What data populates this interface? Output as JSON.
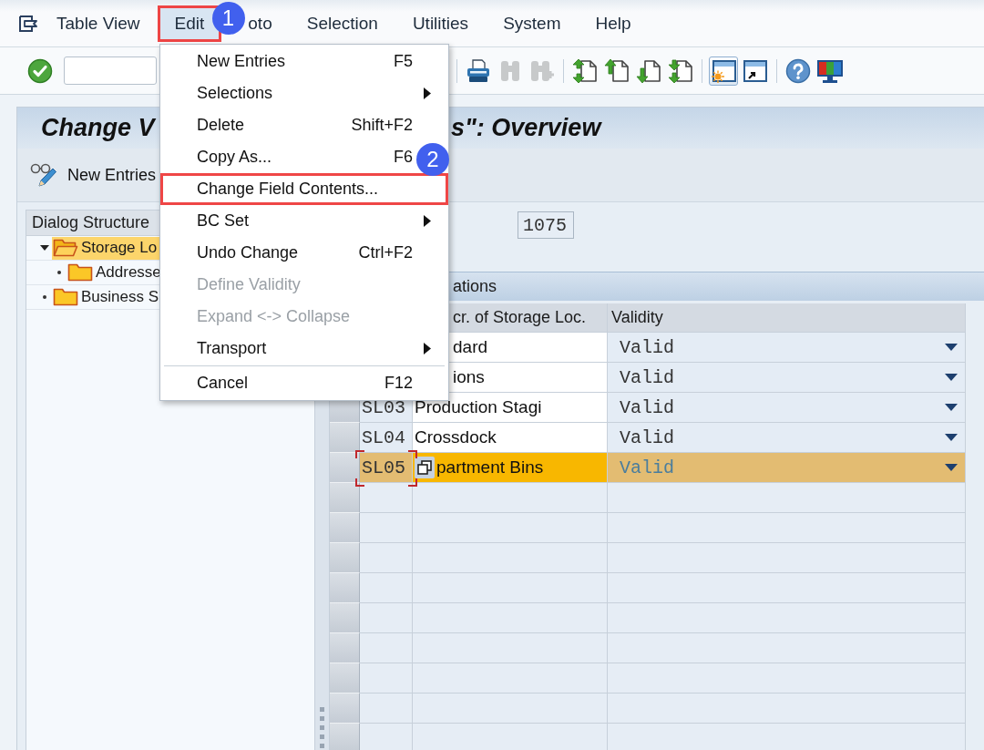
{
  "menu_bar": {
    "items": [
      {
        "label": "Table View",
        "selected": false,
        "outlined": false
      },
      {
        "label": "Edit",
        "selected": true,
        "outlined": true,
        "callout": "1"
      },
      {
        "label": "oto",
        "selected": false,
        "outlined": false
      },
      {
        "label": "Selection",
        "selected": false,
        "outlined": false
      },
      {
        "label": "Utilities",
        "selected": false,
        "outlined": false
      },
      {
        "label": "System",
        "selected": false,
        "outlined": false
      },
      {
        "label": "Help",
        "selected": false,
        "outlined": false
      }
    ]
  },
  "toolbar": {
    "groups": [
      [
        {
          "kind": "enter",
          "disabled": false,
          "pressed": false
        }
      ],
      [
        {
          "kind": "print",
          "disabled": false,
          "pressed": false
        },
        {
          "kind": "find",
          "disabled": true,
          "pressed": false
        },
        {
          "kind": "find_next",
          "disabled": true,
          "pressed": false
        }
      ],
      [
        {
          "kind": "first_page",
          "disabled": false,
          "pressed": false
        },
        {
          "kind": "previous_page",
          "disabled": false,
          "pressed": false
        },
        {
          "kind": "next_page",
          "disabled": false,
          "pressed": false
        },
        {
          "kind": "last_page",
          "disabled": false,
          "pressed": false
        }
      ],
      [
        {
          "kind": "new_session",
          "disabled": false,
          "pressed": true
        },
        {
          "kind": "shortcut",
          "disabled": false,
          "pressed": false
        }
      ],
      [
        {
          "kind": "help",
          "disabled": false,
          "pressed": false
        },
        {
          "kind": "layout",
          "disabled": false,
          "pressed": false
        }
      ]
    ]
  },
  "edit_menu": {
    "groups": [
      [
        {
          "label": "New Entries",
          "shortcut": "F5",
          "submenu": false,
          "disabled": false,
          "outlined": false
        },
        {
          "label": "Selections",
          "submenu": true,
          "disabled": false,
          "outlined": false
        },
        {
          "label": "Delete",
          "shortcut": "Shift+F2",
          "submenu": false,
          "disabled": false,
          "outlined": false
        },
        {
          "label": "Copy As...",
          "shortcut": "F6",
          "submenu": false,
          "disabled": false,
          "outlined": false
        },
        {
          "label": "Change Field Contents...",
          "submenu": false,
          "disabled": false,
          "outlined": true,
          "callout": "2"
        },
        {
          "label": "BC Set",
          "submenu": true,
          "disabled": false,
          "outlined": false
        },
        {
          "label": "Undo Change",
          "shortcut": "Ctrl+F2",
          "submenu": false,
          "disabled": false,
          "outlined": false
        },
        {
          "label": "Define Validity",
          "submenu": false,
          "disabled": true,
          "outlined": false
        },
        {
          "label": "Expand <-> Collapse",
          "submenu": false,
          "disabled": true,
          "outlined": false
        },
        {
          "label": "Transport",
          "submenu": true,
          "disabled": false,
          "outlined": false
        }
      ],
      [
        {
          "label": "Cancel",
          "shortcut": "F12",
          "disabled": false,
          "outlined": false
        }
      ]
    ]
  },
  "screen": {
    "title_start": "Change V",
    "title_end": "s\": Overview"
  },
  "app_toolbar": {
    "buttons": [
      {
        "label": "New Entries"
      }
    ]
  },
  "dialog_structure": {
    "header": "Dialog Structure",
    "tree": [
      {
        "label": "Storage Lo",
        "selected": true,
        "expanded": true,
        "children": [
          {
            "label": "Addresse",
            "selected": false
          }
        ]
      },
      {
        "label": "Business S",
        "selected": false
      }
    ]
  },
  "key_field": {
    "value": "1075"
  },
  "table": {
    "title": "ations",
    "columns": {
      "column_2": "cr. of Storage Loc.",
      "validity": "Validity"
    },
    "rows": [
      {
        "column_2": "dard",
        "validity": "Valid",
        "selected": false,
        "focused": false
      },
      {
        "column_2": "ions",
        "validity": "Valid",
        "selected": false,
        "focused": false
      },
      {
        "column_1": "SL03",
        "column_2": "Production Stagi",
        "validity": "Valid",
        "selected": false,
        "focused": false
      },
      {
        "column_1": "SL04",
        "column_2": "Crossdock",
        "validity": "Valid",
        "selected": false,
        "focused": false
      },
      {
        "column_1": "SL05",
        "column_2": "partment Bins",
        "validity": "Valid",
        "selected": true,
        "focused": true
      }
    ]
  }
}
